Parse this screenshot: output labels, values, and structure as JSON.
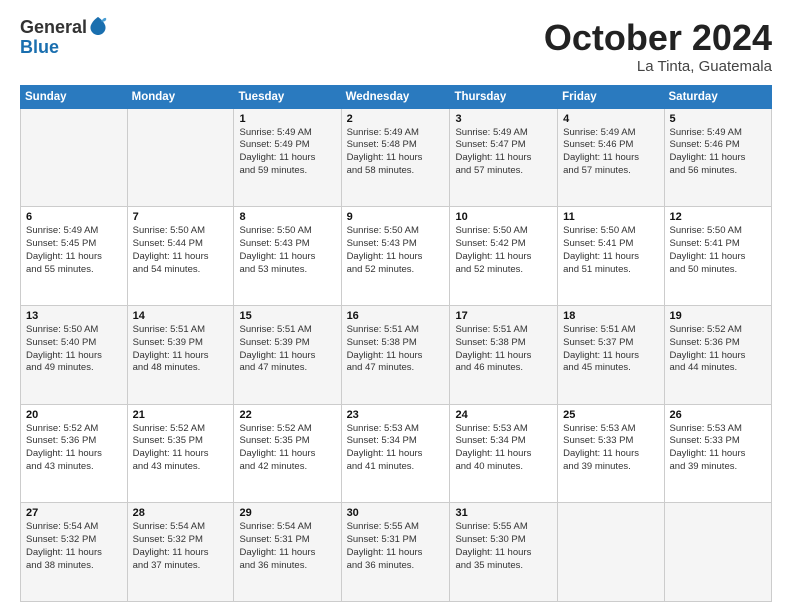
{
  "logo": {
    "general": "General",
    "blue": "Blue"
  },
  "title": "October 2024",
  "location": "La Tinta, Guatemala",
  "days_of_week": [
    "Sunday",
    "Monday",
    "Tuesday",
    "Wednesday",
    "Thursday",
    "Friday",
    "Saturday"
  ],
  "weeks": [
    [
      {
        "day": "",
        "info": ""
      },
      {
        "day": "",
        "info": ""
      },
      {
        "day": "1",
        "info": "Sunrise: 5:49 AM\nSunset: 5:49 PM\nDaylight: 11 hours\nand 59 minutes."
      },
      {
        "day": "2",
        "info": "Sunrise: 5:49 AM\nSunset: 5:48 PM\nDaylight: 11 hours\nand 58 minutes."
      },
      {
        "day": "3",
        "info": "Sunrise: 5:49 AM\nSunset: 5:47 PM\nDaylight: 11 hours\nand 57 minutes."
      },
      {
        "day": "4",
        "info": "Sunrise: 5:49 AM\nSunset: 5:46 PM\nDaylight: 11 hours\nand 57 minutes."
      },
      {
        "day": "5",
        "info": "Sunrise: 5:49 AM\nSunset: 5:46 PM\nDaylight: 11 hours\nand 56 minutes."
      }
    ],
    [
      {
        "day": "6",
        "info": "Sunrise: 5:49 AM\nSunset: 5:45 PM\nDaylight: 11 hours\nand 55 minutes."
      },
      {
        "day": "7",
        "info": "Sunrise: 5:50 AM\nSunset: 5:44 PM\nDaylight: 11 hours\nand 54 minutes."
      },
      {
        "day": "8",
        "info": "Sunrise: 5:50 AM\nSunset: 5:43 PM\nDaylight: 11 hours\nand 53 minutes."
      },
      {
        "day": "9",
        "info": "Sunrise: 5:50 AM\nSunset: 5:43 PM\nDaylight: 11 hours\nand 52 minutes."
      },
      {
        "day": "10",
        "info": "Sunrise: 5:50 AM\nSunset: 5:42 PM\nDaylight: 11 hours\nand 52 minutes."
      },
      {
        "day": "11",
        "info": "Sunrise: 5:50 AM\nSunset: 5:41 PM\nDaylight: 11 hours\nand 51 minutes."
      },
      {
        "day": "12",
        "info": "Sunrise: 5:50 AM\nSunset: 5:41 PM\nDaylight: 11 hours\nand 50 minutes."
      }
    ],
    [
      {
        "day": "13",
        "info": "Sunrise: 5:50 AM\nSunset: 5:40 PM\nDaylight: 11 hours\nand 49 minutes."
      },
      {
        "day": "14",
        "info": "Sunrise: 5:51 AM\nSunset: 5:39 PM\nDaylight: 11 hours\nand 48 minutes."
      },
      {
        "day": "15",
        "info": "Sunrise: 5:51 AM\nSunset: 5:39 PM\nDaylight: 11 hours\nand 47 minutes."
      },
      {
        "day": "16",
        "info": "Sunrise: 5:51 AM\nSunset: 5:38 PM\nDaylight: 11 hours\nand 47 minutes."
      },
      {
        "day": "17",
        "info": "Sunrise: 5:51 AM\nSunset: 5:38 PM\nDaylight: 11 hours\nand 46 minutes."
      },
      {
        "day": "18",
        "info": "Sunrise: 5:51 AM\nSunset: 5:37 PM\nDaylight: 11 hours\nand 45 minutes."
      },
      {
        "day": "19",
        "info": "Sunrise: 5:52 AM\nSunset: 5:36 PM\nDaylight: 11 hours\nand 44 minutes."
      }
    ],
    [
      {
        "day": "20",
        "info": "Sunrise: 5:52 AM\nSunset: 5:36 PM\nDaylight: 11 hours\nand 43 minutes."
      },
      {
        "day": "21",
        "info": "Sunrise: 5:52 AM\nSunset: 5:35 PM\nDaylight: 11 hours\nand 43 minutes."
      },
      {
        "day": "22",
        "info": "Sunrise: 5:52 AM\nSunset: 5:35 PM\nDaylight: 11 hours\nand 42 minutes."
      },
      {
        "day": "23",
        "info": "Sunrise: 5:53 AM\nSunset: 5:34 PM\nDaylight: 11 hours\nand 41 minutes."
      },
      {
        "day": "24",
        "info": "Sunrise: 5:53 AM\nSunset: 5:34 PM\nDaylight: 11 hours\nand 40 minutes."
      },
      {
        "day": "25",
        "info": "Sunrise: 5:53 AM\nSunset: 5:33 PM\nDaylight: 11 hours\nand 39 minutes."
      },
      {
        "day": "26",
        "info": "Sunrise: 5:53 AM\nSunset: 5:33 PM\nDaylight: 11 hours\nand 39 minutes."
      }
    ],
    [
      {
        "day": "27",
        "info": "Sunrise: 5:54 AM\nSunset: 5:32 PM\nDaylight: 11 hours\nand 38 minutes."
      },
      {
        "day": "28",
        "info": "Sunrise: 5:54 AM\nSunset: 5:32 PM\nDaylight: 11 hours\nand 37 minutes."
      },
      {
        "day": "29",
        "info": "Sunrise: 5:54 AM\nSunset: 5:31 PM\nDaylight: 11 hours\nand 36 minutes."
      },
      {
        "day": "30",
        "info": "Sunrise: 5:55 AM\nSunset: 5:31 PM\nDaylight: 11 hours\nand 36 minutes."
      },
      {
        "day": "31",
        "info": "Sunrise: 5:55 AM\nSunset: 5:30 PM\nDaylight: 11 hours\nand 35 minutes."
      },
      {
        "day": "",
        "info": ""
      },
      {
        "day": "",
        "info": ""
      }
    ]
  ]
}
